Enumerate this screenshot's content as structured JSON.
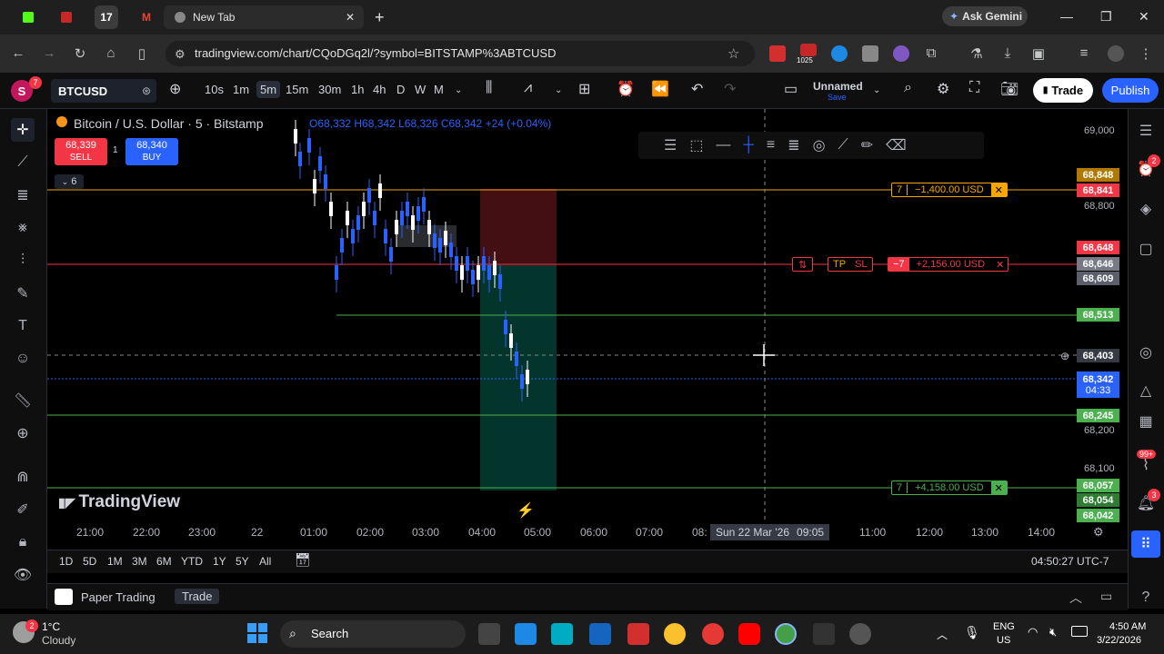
{
  "browser": {
    "active_tab_title": "New Tab",
    "url": "tradingview.com/chart/CQoDGq2l/?symbol=BITSTAMP%3ABTCUSD",
    "ask_gemini": "Ask Gemini",
    "ext_badge": "1025"
  },
  "toolbar": {
    "avatar_letter": "S",
    "avatar_badge": "7",
    "symbol": "BTCUSD",
    "intervals": [
      "10s",
      "1m",
      "5m",
      "15m",
      "30m",
      "1h",
      "4h",
      "D",
      "W",
      "M"
    ],
    "selected_interval": "5m",
    "layout_name": "Unnamed",
    "layout_status": "Save",
    "trade_label": "Trade",
    "publish_label": "Publish"
  },
  "legend": {
    "title": "Bitcoin / U.S. Dollar · 5 · Bitstamp",
    "open": "O68,332",
    "high": "H68,342",
    "low": "L68,326",
    "close": "C68,342",
    "change": "+24 (+0.04%)",
    "sell_price": "68,339",
    "sell_label": "SELL",
    "spread": "1",
    "buy_price": "68,340",
    "buy_label": "BUY",
    "indicator_count": "6"
  },
  "orders": {
    "limit_top": {
      "qty": "7",
      "pnl": "−1,400.00 USD"
    },
    "position": {
      "flag": "⇅",
      "tp": "TP",
      "sl": "SL",
      "qty": "−7",
      "pnl": "+2,156.00 USD"
    },
    "limit_bottom": {
      "qty": "7",
      "pnl": "+4,158.00 USD"
    }
  },
  "price_axis": {
    "labels": [
      "69,000",
      "68,800",
      "68,200",
      "68,100"
    ],
    "tags": {
      "p68848": "68,848",
      "p68841": "68,841",
      "p68648": "68,648",
      "p68646": "68,646",
      "p68609": "68,609",
      "p68513": "68,513",
      "p68403": "68,403",
      "current": "68,342",
      "countdown": "04:33",
      "p68245": "68,245",
      "p68057": "68,057",
      "p68054": "68,054",
      "p68042": "68,042"
    },
    "colors": {
      "orange": "#f7a600",
      "red": "#f23645",
      "green": "#4caf50",
      "blue": "#2962ff",
      "gray": "#787b86"
    }
  },
  "time_axis": {
    "labels": [
      "21:00",
      "22:00",
      "23:00",
      "22",
      "01:00",
      "02:00",
      "03:00",
      "04:00",
      "05:00",
      "06:00",
      "07:00",
      "08:",
      "0",
      "11:00",
      "12:00",
      "13:00",
      "14:00"
    ],
    "crosshair_label": "Sun 22 Mar '26",
    "crosshair_time": "09:05"
  },
  "watermark": "TradingView",
  "range_bar": {
    "ranges": [
      "1D",
      "5D",
      "1M",
      "3M",
      "6M",
      "YTD",
      "1Y",
      "5Y",
      "All"
    ],
    "clock": "04:50:27 UTC-7"
  },
  "panel": {
    "title": "Paper Trading",
    "trade": "Trade"
  },
  "taskbar": {
    "weather_temp": "1°C",
    "weather_desc": "Cloudy",
    "weather_badge": "2",
    "search_placeholder": "Search",
    "lang": "ENG",
    "region": "US",
    "time": "4:50 AM",
    "date": "3/22/2026"
  },
  "badges": {
    "alerts": "2",
    "notifications": "99+",
    "ideas": "3"
  }
}
